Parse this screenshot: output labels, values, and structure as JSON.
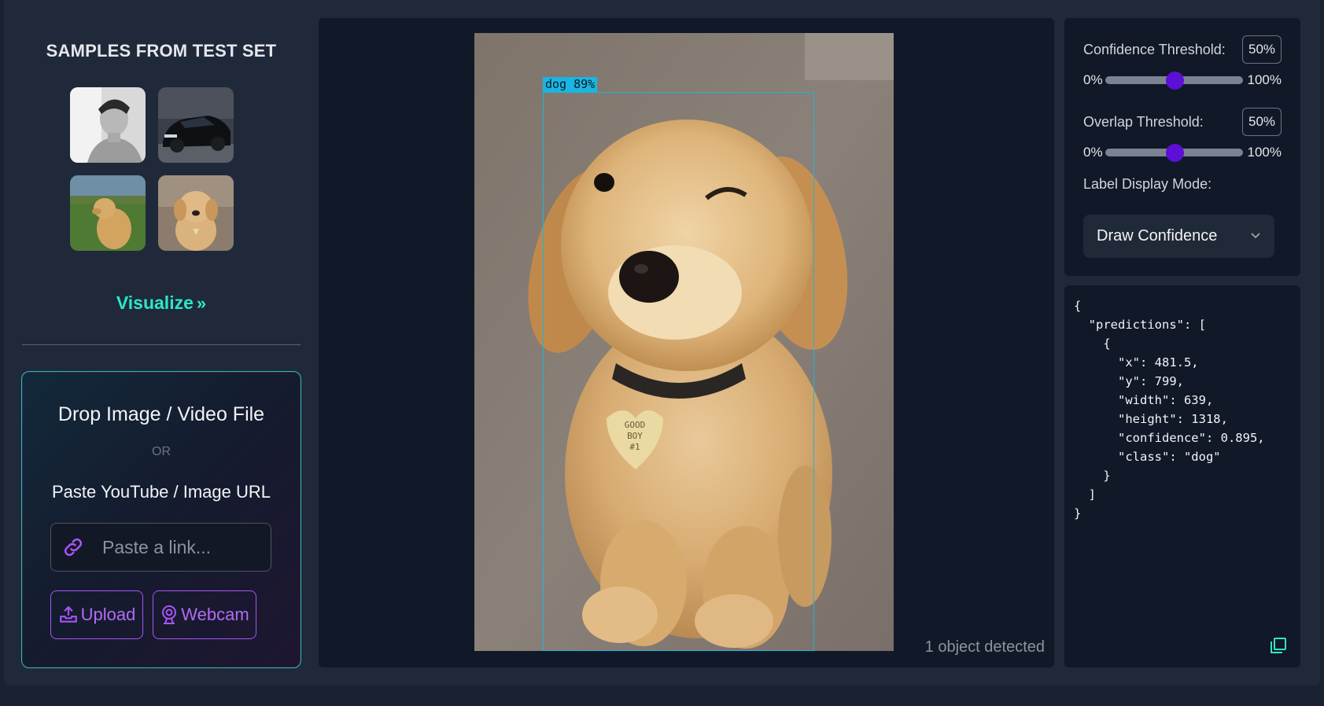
{
  "sidebar": {
    "title": "SAMPLES FROM TEST SET",
    "thumbnails": [
      "man-portrait",
      "black-car",
      "puppy-on-grass",
      "puppy-sitting"
    ],
    "visualize_label": "Visualize",
    "visualize_icon": "chevron-double-right-icon",
    "drop_title": "Drop Image / Video File",
    "drop_or": "OR",
    "paste_label": "Paste YouTube / Image URL",
    "link_placeholder": "Paste a link...",
    "upload_label": "Upload",
    "webcam_label": "Webcam"
  },
  "viewer": {
    "detection_label": "dog 89%",
    "status": "1 object detected"
  },
  "controls": {
    "confidence_label": "Confidence Threshold:",
    "confidence_value": "50%",
    "confidence_fraction": 0.5,
    "overlap_label": "Overlap Threshold:",
    "overlap_value": "50%",
    "overlap_fraction": 0.5,
    "range_min": "0%",
    "range_max": "100%",
    "label_mode_label": "Label Display Mode:",
    "label_mode_value": "Draw Confidence"
  },
  "json_output": "{\n  \"predictions\": [\n    {\n      \"x\": 481.5,\n      \"y\": 799,\n      \"width\": 639,\n      \"height\": 1318,\n      \"confidence\": 0.895,\n      \"class\": \"dog\"\n    }\n  ]\n}",
  "colors": {
    "accent_teal": "#2ee6c7",
    "accent_purple": "#a855f7",
    "slider_knob": "#5c0fd6",
    "bbox": "#1eb4dc"
  }
}
